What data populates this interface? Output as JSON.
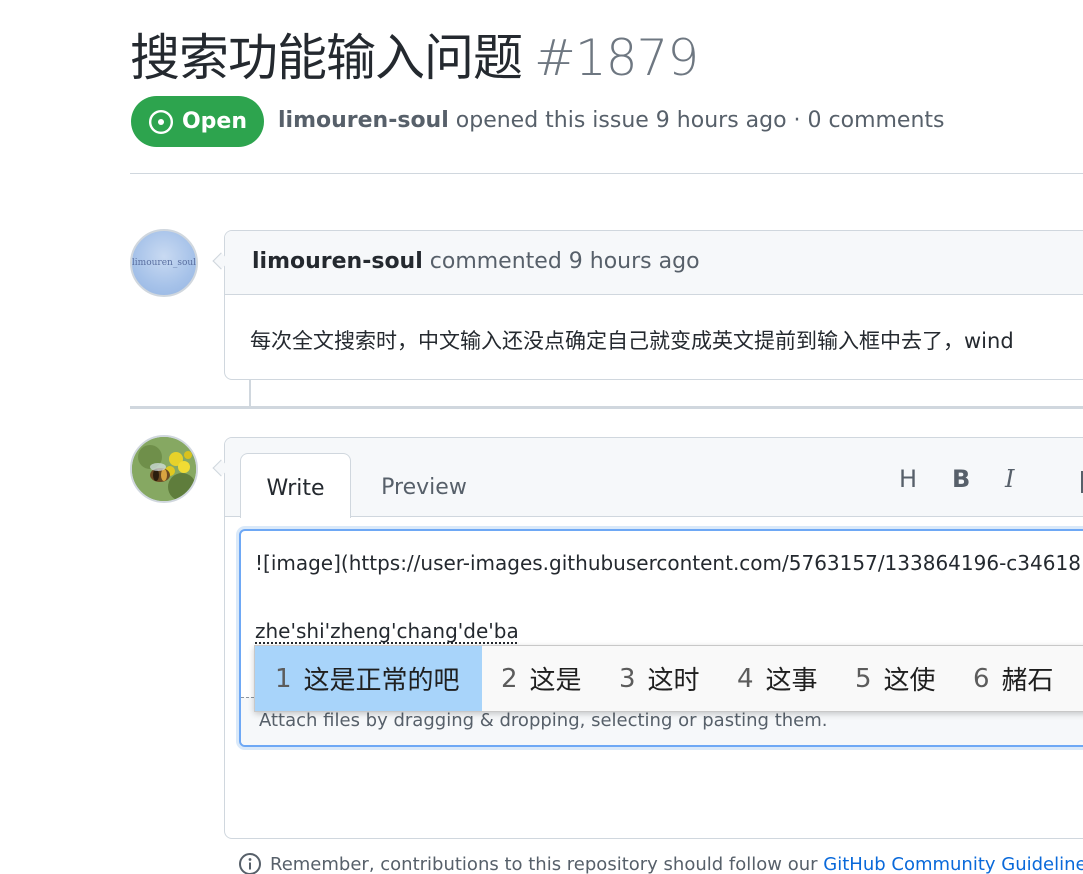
{
  "issue": {
    "title": "搜索功能输入问题",
    "number": "#1879",
    "state_label": "Open",
    "author": "limouren-soul",
    "meta_text": "opened this issue 9 hours ago · 0 comments"
  },
  "comment": {
    "avatar_text": "limouren_soul",
    "author": "limouren-soul",
    "time_text": "commented 9 hours ago",
    "body": "每次全文搜索时，中文输入还没点确定自己就变成英文提前到输入框中去了，wind"
  },
  "editor": {
    "tab_write": "Write",
    "tab_preview": "Preview",
    "tool_heading": "H",
    "tool_bold": "B",
    "tool_italic": "I",
    "textarea_line1": "![image](https://user-images.githubusercontent.com/5763157/133864196-c34618",
    "textarea_line2": "zhe'shi'zheng'chang'de'ba",
    "attach_hint": "Attach files by dragging & dropping, selecting or pasting them."
  },
  "ime": {
    "candidates": [
      {
        "n": "1",
        "text": "这是正常的吧"
      },
      {
        "n": "2",
        "text": "这是"
      },
      {
        "n": "3",
        "text": "这时"
      },
      {
        "n": "4",
        "text": "这事"
      },
      {
        "n": "5",
        "text": "这使"
      },
      {
        "n": "6",
        "text": "赭石"
      }
    ],
    "selected_index": 0
  },
  "footer": {
    "text": "Remember, contributions to this repository should follow our",
    "link": "GitHub Community Guidelines",
    "end": "."
  },
  "colors": {
    "open_green": "#2da44e",
    "link_blue": "#0969da",
    "ime_selected": "#a8d4fa",
    "focus_border": "#6ea8f5"
  },
  "icons": [
    "issue-opened-icon",
    "info-icon"
  ]
}
